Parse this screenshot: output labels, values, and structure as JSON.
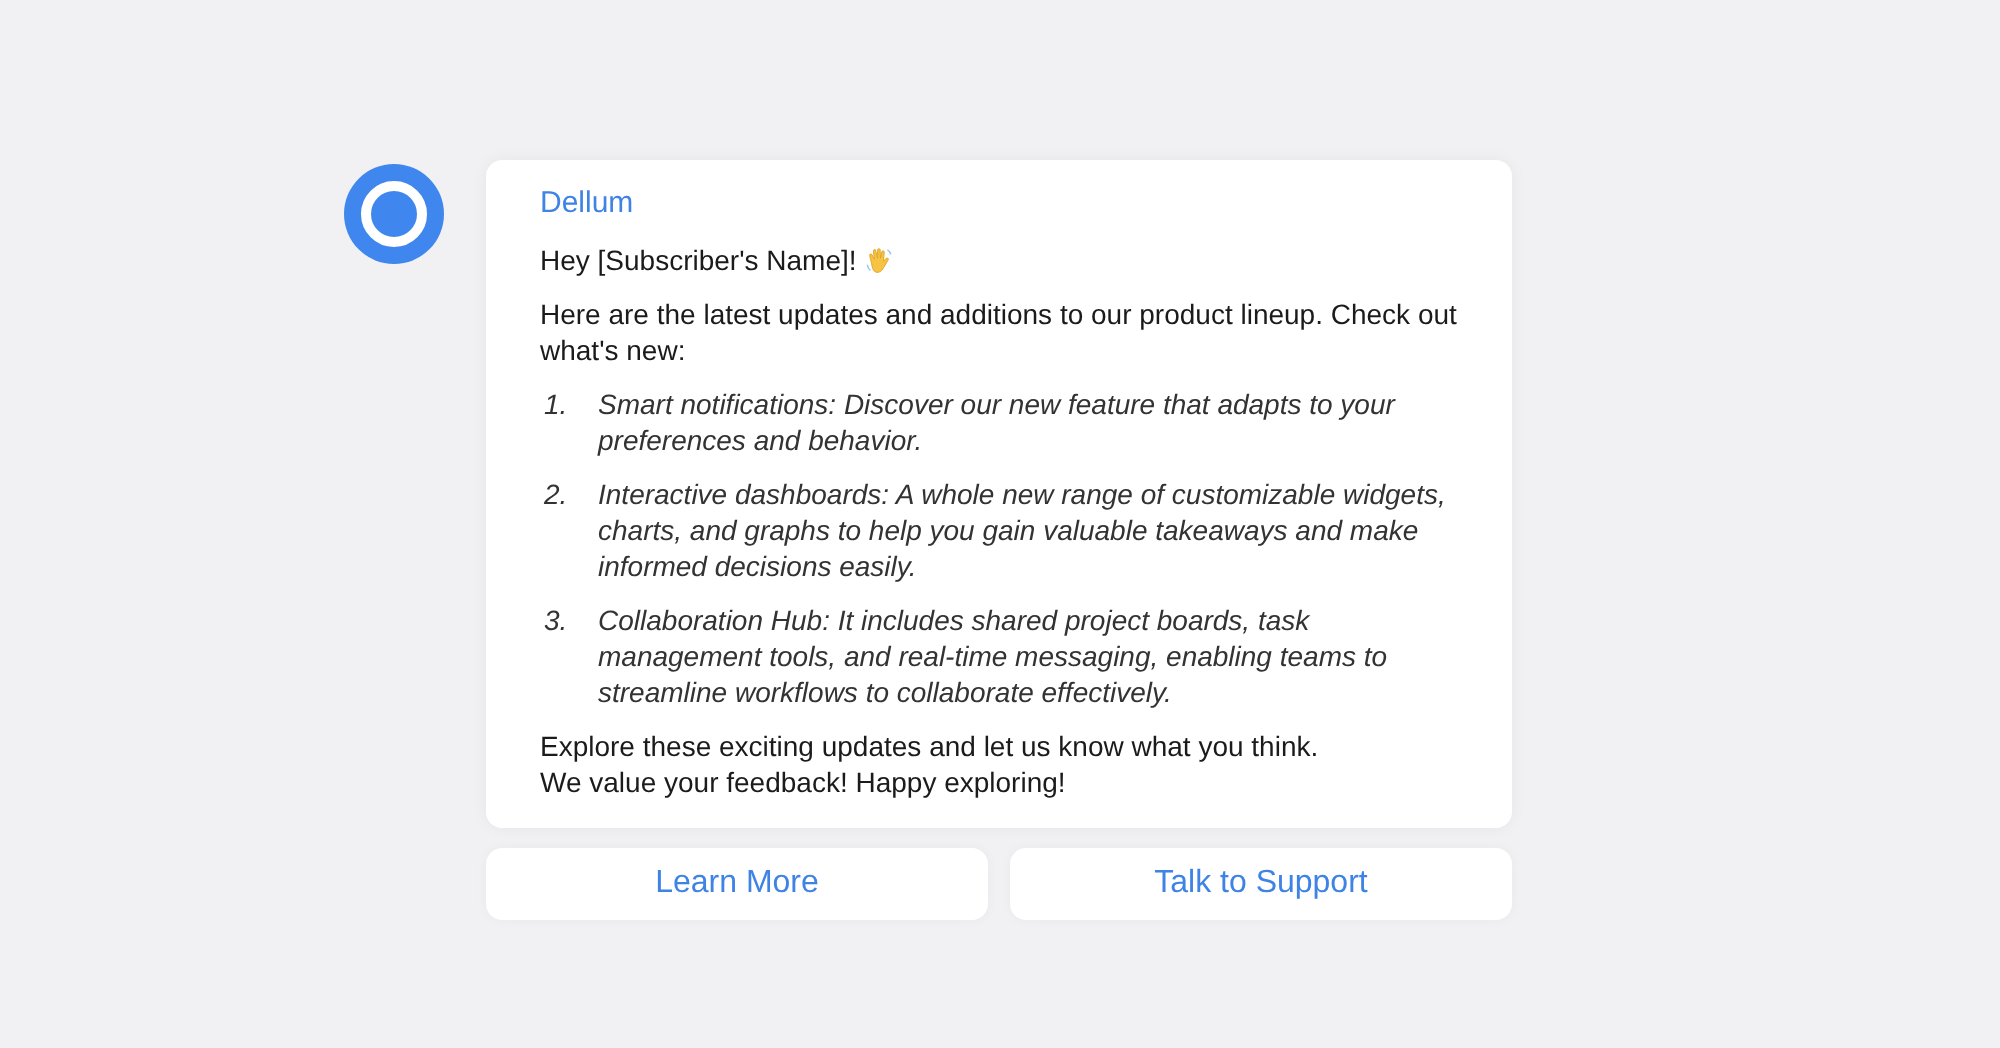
{
  "message": {
    "sender": "Dellum",
    "greeting": "Hey [Subscriber's Name]!",
    "intro": "Here are the latest updates and additions to our product lineup. Check out what's new:",
    "items": [
      {
        "number": "1.",
        "text": "Smart notifications: Discover our new feature that adapts to your preferences and behavior."
      },
      {
        "number": "2.",
        "text": "Interactive dashboards: A whole new range of customizable widgets, charts, and graphs to help you gain valuable takeaways and make informed decisions easily."
      },
      {
        "number": "3.",
        "text": "Collaboration Hub: It includes shared project boards, task management tools, and real-time messaging, enabling teams to streamline workflows to collaborate effectively."
      }
    ],
    "closing": [
      "Explore these exciting updates and let us know what you think.",
      "We value your feedback! Happy exploring!"
    ]
  },
  "buttons": [
    "Learn More",
    "Talk to Support"
  ]
}
